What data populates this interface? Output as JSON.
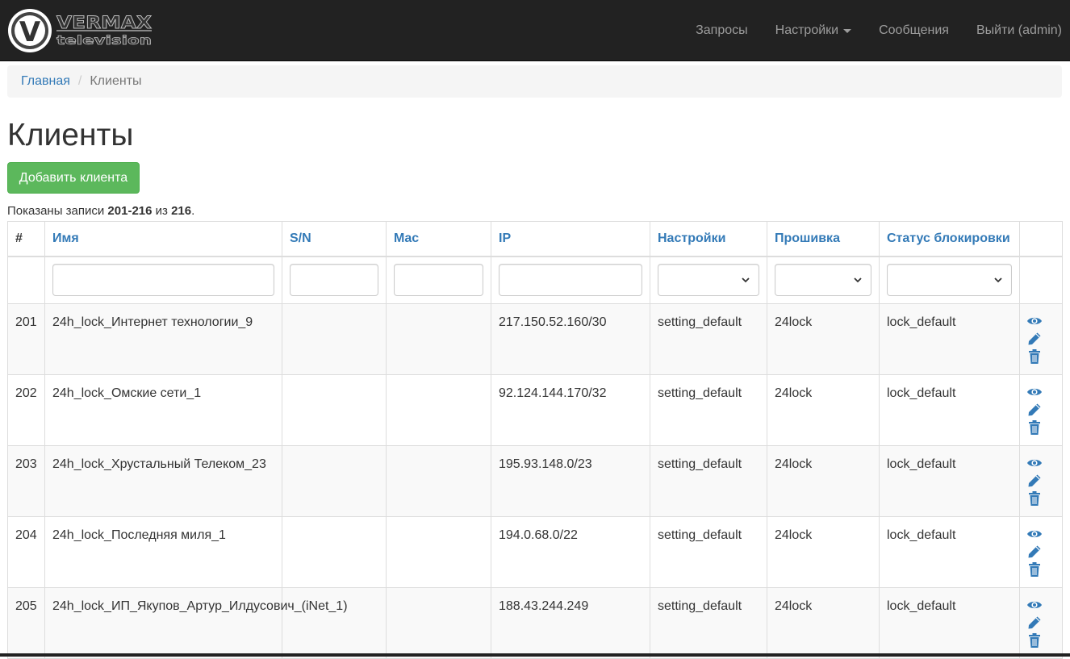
{
  "brand": {
    "name_line1": "VERMAX",
    "name_line2": "television",
    "logo_letter": "V"
  },
  "nav": {
    "requests": "Запросы",
    "settings": "Настройки",
    "messages": "Сообщения",
    "logout": "Выйти (admin)"
  },
  "breadcrumb": {
    "home": "Главная",
    "sep": "/",
    "current": "Клиенты"
  },
  "page": {
    "title": "Клиенты",
    "add_button": "Добавить клиента",
    "summary_prefix": "Показаны записи ",
    "summary_range": "201-216",
    "summary_mid": " из ",
    "summary_total": "216",
    "summary_suffix": "."
  },
  "table": {
    "columns": [
      "#",
      "Имя",
      "S/N",
      "Mac",
      "IP",
      "Настройки",
      "Прошивка",
      "Статус блокировки",
      ""
    ],
    "rows": [
      {
        "num": "201",
        "name": "24h_lock_Интернет технологии_9",
        "sn": "",
        "mac": "",
        "ip": "217.150.52.160/30",
        "settings": "setting_default",
        "firmware": "24lock",
        "lock": "lock_default"
      },
      {
        "num": "202",
        "name": "24h_lock_Омские сети_1",
        "sn": "",
        "mac": "",
        "ip": "92.124.144.170/32",
        "settings": "setting_default",
        "firmware": "24lock",
        "lock": "lock_default"
      },
      {
        "num": "203",
        "name": "24h_lock_Хрустальный Телеком_23",
        "sn": "",
        "mac": "",
        "ip": "195.93.148.0/23",
        "settings": "setting_default",
        "firmware": "24lock",
        "lock": "lock_default"
      },
      {
        "num": "204",
        "name": "24h_lock_Последняя миля_1",
        "sn": "",
        "mac": "",
        "ip": "194.0.68.0/22",
        "settings": "setting_default",
        "firmware": "24lock",
        "lock": "lock_default"
      },
      {
        "num": "205",
        "name": "24h_lock_ИП_Якупов_Артур_Илдусович_(iNet_1)",
        "sn": "",
        "mac": "",
        "ip": "188.43.244.249",
        "settings": "setting_default",
        "firmware": "24lock",
        "lock": "lock_default"
      }
    ],
    "row_actions": [
      "eye-icon",
      "pencil-icon",
      "trash-icon"
    ]
  },
  "colors": {
    "navbar": "#222222",
    "link": "#337ab7",
    "success": "#5cb85c",
    "stripe": "#f9f9f9",
    "border": "#dddddd"
  }
}
